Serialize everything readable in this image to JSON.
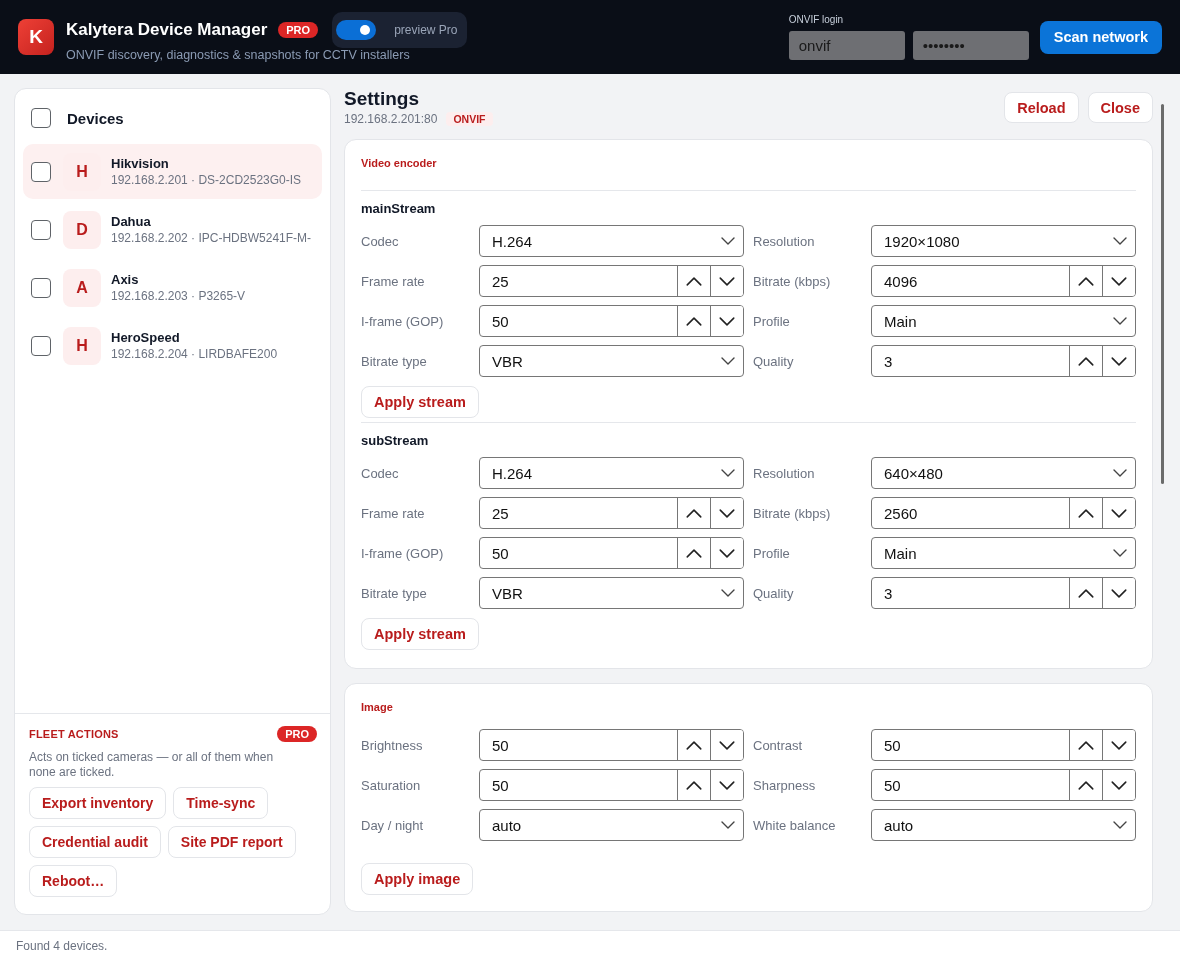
{
  "header": {
    "logo": "K",
    "title": "Kalytera Device Manager",
    "badge": "PRO",
    "subtitle": "ONVIF discovery, diagnostics & snapshots for CCTV installers",
    "preview_toggle": {
      "label": "preview Pro",
      "on": true
    },
    "login": {
      "label": "ONVIF login",
      "username": "onvif",
      "password": "••••••••"
    },
    "scan_button": "Scan network"
  },
  "sidebar": {
    "title": "Devices",
    "all_checked": false,
    "devices": [
      {
        "letter": "H",
        "name": "Hikvision",
        "subtitle": "192.168.2.201 · DS-2CD2523G0-IS",
        "selected": true,
        "checked": false
      },
      {
        "letter": "D",
        "name": "Dahua",
        "subtitle": "192.168.2.202 · IPC-HDBW5241F-M-",
        "selected": false,
        "checked": false
      },
      {
        "letter": "A",
        "name": "Axis",
        "subtitle": "192.168.2.203 · P3265-V",
        "selected": false,
        "checked": false
      },
      {
        "letter": "H",
        "name": "HeroSpeed",
        "subtitle": "192.168.2.204 · LIRDBAFE200",
        "selected": false,
        "checked": false
      }
    ],
    "fleet_actions": {
      "title": "FLEET ACTIONS",
      "badge": "PRO",
      "description": "Acts on ticked cameras — or all of them when none are ticked.",
      "buttons": [
        "Export inventory",
        "Time-sync",
        "Credential audit",
        "Site PDF report",
        "Reboot…"
      ]
    }
  },
  "settings": {
    "title": "Settings",
    "address": "192.168.2.201:80",
    "protocol": "ONVIF",
    "actions": [
      "Reload",
      "Close"
    ],
    "sections": [
      {
        "kind": "streams",
        "title": "Video encoder",
        "streams": [
          {
            "name": "mainStream",
            "fields": [
              {
                "label": "Codec",
                "kind": "select",
                "value": "H.264"
              },
              {
                "label": "Resolution",
                "kind": "select",
                "value": "1920×1080"
              },
              {
                "label": "Frame rate",
                "kind": "number",
                "value": "25"
              },
              {
                "label": "Bitrate (kbps)",
                "kind": "number",
                "value": "4096"
              },
              {
                "label": "I-frame (GOP)",
                "kind": "number",
                "value": "50"
              },
              {
                "label": "Profile",
                "kind": "select",
                "value": "Main"
              },
              {
                "label": "Bitrate type",
                "kind": "select",
                "value": "VBR"
              },
              {
                "label": "Quality",
                "kind": "number",
                "value": "3"
              }
            ],
            "apply_button": "Apply stream"
          },
          {
            "name": "subStream",
            "fields": [
              {
                "label": "Codec",
                "kind": "select",
                "value": "H.264"
              },
              {
                "label": "Resolution",
                "kind": "select",
                "value": "640×480"
              },
              {
                "label": "Frame rate",
                "kind": "number",
                "value": "25"
              },
              {
                "label": "Bitrate (kbps)",
                "kind": "number",
                "value": "2560"
              },
              {
                "label": "I-frame (GOP)",
                "kind": "number",
                "value": "50"
              },
              {
                "label": "Profile",
                "kind": "select",
                "value": "Main"
              },
              {
                "label": "Bitrate type",
                "kind": "select",
                "value": "VBR"
              },
              {
                "label": "Quality",
                "kind": "number",
                "value": "3"
              }
            ],
            "apply_button": "Apply stream"
          }
        ]
      },
      {
        "kind": "fields",
        "title": "Image",
        "fields": [
          {
            "label": "Brightness",
            "kind": "number",
            "value": "50"
          },
          {
            "label": "Contrast",
            "kind": "number",
            "value": "50"
          },
          {
            "label": "Saturation",
            "kind": "number",
            "value": "50"
          },
          {
            "label": "Sharpness",
            "kind": "number",
            "value": "50"
          },
          {
            "label": "Day / night",
            "kind": "select",
            "value": "auto"
          },
          {
            "label": "White balance",
            "kind": "select",
            "value": "auto"
          }
        ],
        "apply_button": "Apply image"
      }
    ]
  },
  "status_bar": "Found 4 devices."
}
